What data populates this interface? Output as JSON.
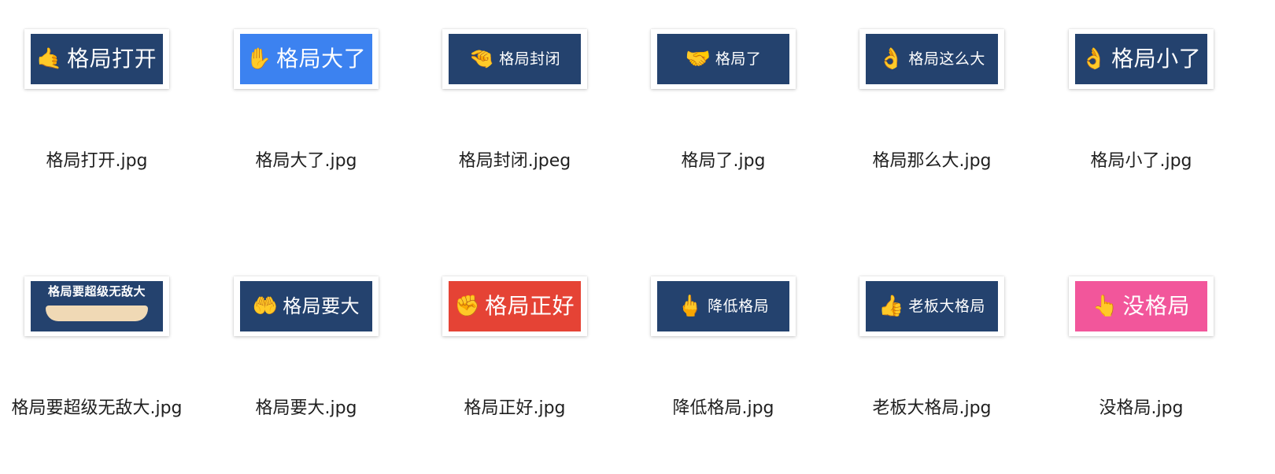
{
  "colors": {
    "navy": "#24426e",
    "blue": "#3c82f0",
    "red": "#e54335",
    "pink": "#f2569b"
  },
  "files": [
    {
      "name": "格局打开.jpg",
      "thumb_text": "格局打开",
      "thumb_icon": "🤙",
      "icon_name": "open-arm-icon",
      "bg": "#24426e",
      "style": "t-big"
    },
    {
      "name": "格局大了.jpg",
      "thumb_text": "格局大了",
      "thumb_icon": "✋",
      "icon_name": "raised-hand-icon",
      "bg": "#3c82f0",
      "style": "t-big"
    },
    {
      "name": "格局封闭.jpeg",
      "thumb_text": "格局封闭",
      "thumb_icon": "🤏",
      "icon_name": "closed-hand-icon",
      "bg": "#24426e",
      "style": "t-small"
    },
    {
      "name": "格局了.jpg",
      "thumb_text": "格局了",
      "thumb_icon": "🤝",
      "icon_name": "handshake-icon",
      "bg": "#24426e",
      "style": "t-small"
    },
    {
      "name": "格局那么大.jpg",
      "thumb_text": "格局这么大",
      "thumb_icon": "👌",
      "icon_name": "ok-hand-icon",
      "bg": "#24426e",
      "style": "t-small"
    },
    {
      "name": "格局小了.jpg",
      "thumb_text": "格局小了",
      "thumb_icon": "👌",
      "icon_name": "pinch-hand-icon",
      "bg": "#24426e",
      "style": "t-big"
    },
    {
      "name": "格局要超级无敌大.jpg",
      "thumb_text": "格局要超级无敌大",
      "thumb_icon": "",
      "icon_name": "long-arm-icon",
      "bg": "#24426e",
      "style": "t-stack"
    },
    {
      "name": "格局要大.jpg",
      "thumb_text": "格局要大",
      "thumb_icon": "🤲",
      "icon_name": "wide-arm-icon",
      "bg": "#24426e",
      "style": ""
    },
    {
      "name": "格局正好.jpg",
      "thumb_text": "格局正好",
      "thumb_icon": "✊",
      "icon_name": "fist-icon",
      "bg": "#e54335",
      "style": "t-big"
    },
    {
      "name": "降低格局.jpg",
      "thumb_text": "降低格局",
      "thumb_icon": "🖕",
      "icon_name": "middle-finger-icon",
      "bg": "#24426e",
      "style": "t-small"
    },
    {
      "name": "老板大格局.jpg",
      "thumb_text": "老板大格局",
      "thumb_icon": "👍",
      "icon_name": "thumbs-up-icon",
      "bg": "#24426e",
      "style": "t-small"
    },
    {
      "name": "没格局.jpg",
      "thumb_text": "没格局",
      "thumb_icon": "👆",
      "icon_name": "pointing-finger-icon",
      "bg": "#f2569b",
      "style": "t-big"
    }
  ]
}
